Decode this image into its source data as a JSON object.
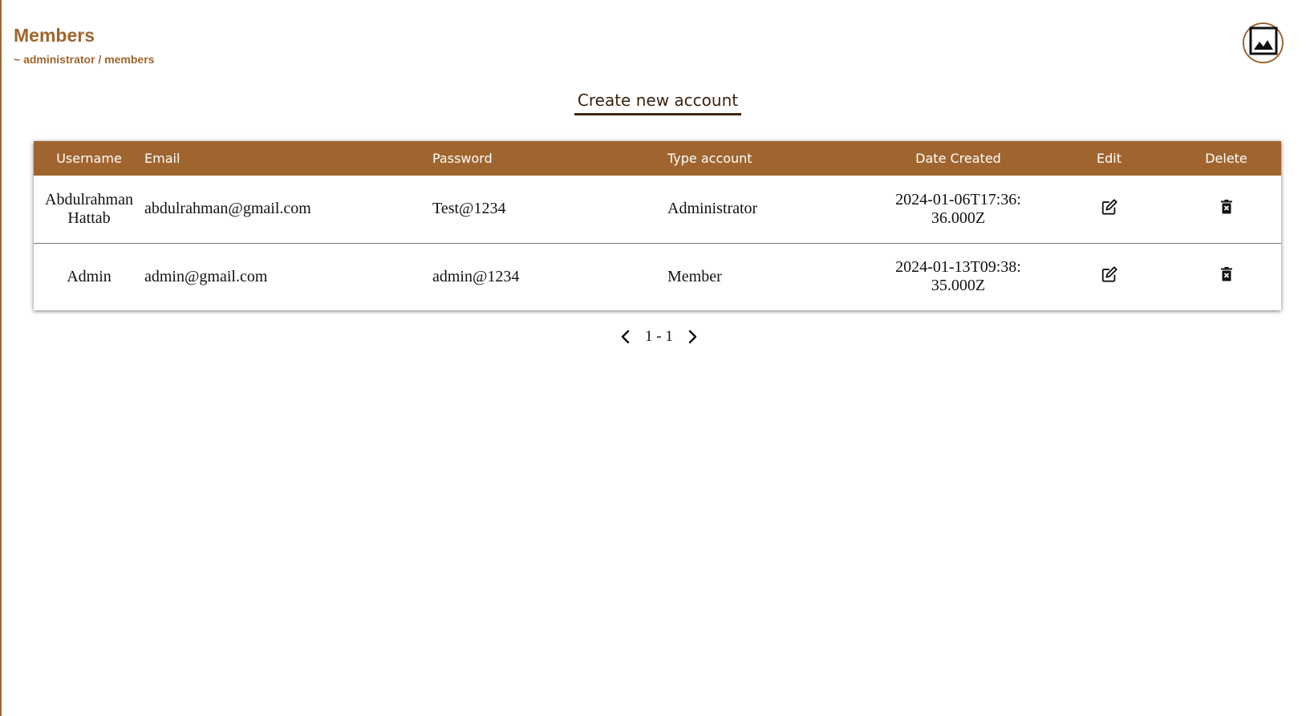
{
  "header": {
    "title": "Members",
    "breadcrumb": "~ administrator / members"
  },
  "avatar": {
    "icon": "image-placeholder-icon"
  },
  "actions": {
    "create_label": "Create new account"
  },
  "table": {
    "headers": {
      "username": "Username",
      "email": "Email",
      "password": "Password",
      "type": "Type account",
      "date": "Date Created",
      "edit": "Edit",
      "delete": "Delete"
    },
    "rows": [
      {
        "username": "Abdulrahman Hattab",
        "email": "abdulrahman@gmail.com",
        "password": "Test@1234",
        "type": "Administrator",
        "date": "2024-01-06T17:36:36.000Z"
      },
      {
        "username": "Admin",
        "email": "admin@gmail.com",
        "password": "admin@1234",
        "type": "Member",
        "date": "2024-01-13T09:38:35.000Z"
      }
    ]
  },
  "pagination": {
    "range": "1 - 1"
  },
  "colors": {
    "accent": "#a0652f",
    "dark": "#3b2410"
  }
}
